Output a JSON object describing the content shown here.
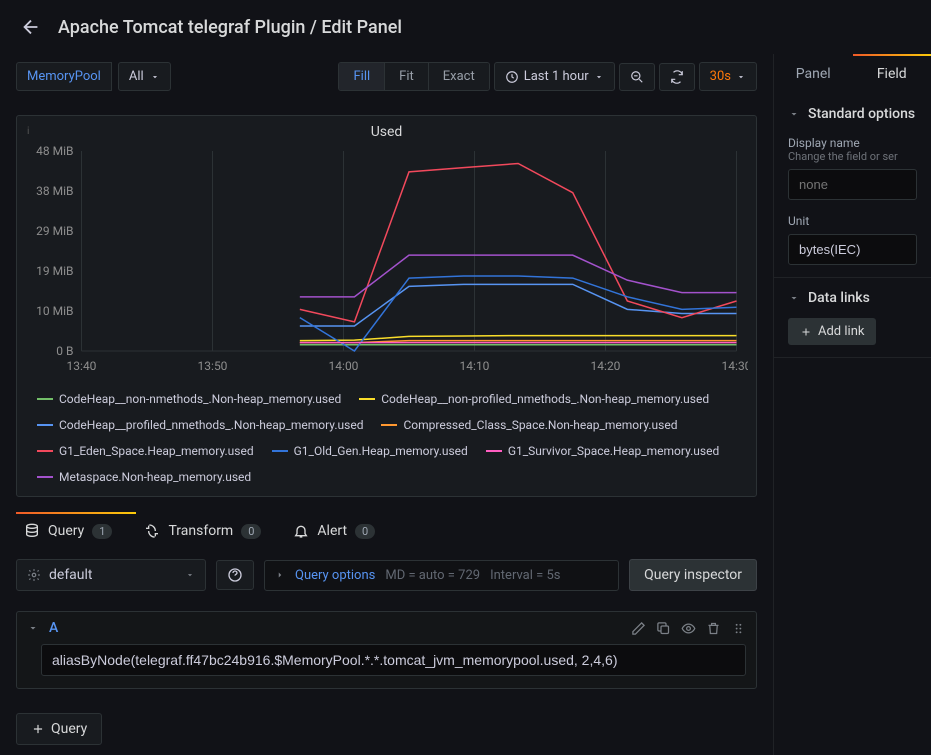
{
  "header": {
    "title": "Apache Tomcat telegraf Plugin / Edit Panel"
  },
  "toolbar": {
    "var_name": "MemoryPool",
    "var_value": "All",
    "mode_fill": "Fill",
    "mode_fit": "Fit",
    "mode_exact": "Exact",
    "time_range": "Last 1 hour",
    "refresh_interval": "30s"
  },
  "chart_data": {
    "type": "line",
    "title": "Used",
    "xlabel": "",
    "ylabel": "",
    "x_ticks": [
      "13:40",
      "13:50",
      "14:00",
      "14:10",
      "14:20",
      "14:30"
    ],
    "y_ticks": [
      "0 B",
      "10 MiB",
      "19 MiB",
      "29 MiB",
      "38 MiB",
      "48 MiB"
    ],
    "ylim": [
      0,
      48
    ],
    "series": [
      {
        "name": "CodeHeap__non-nmethods_.Non-heap_memory.used",
        "color": "#73bf69",
        "values": [
          null,
          null,
          null,
          null,
          1.5,
          1.5,
          1.5,
          1.5,
          1.5,
          1.5,
          1.5,
          1.5,
          1.5
        ]
      },
      {
        "name": "CodeHeap__non-profiled_nmethods_.Non-heap_memory.used",
        "color": "#fade2a",
        "values": [
          null,
          null,
          null,
          null,
          2.5,
          2.6,
          3.5,
          3.6,
          3.7,
          3.7,
          3.7,
          3.7,
          3.7
        ]
      },
      {
        "name": "CodeHeap__profiled_nmethods_.Non-heap_memory.used",
        "color": "#5794f2",
        "values": [
          null,
          null,
          null,
          null,
          6,
          6,
          15.5,
          16,
          16,
          16,
          10,
          9,
          9
        ]
      },
      {
        "name": "Compressed_Class_Space.Non-heap_memory.used",
        "color": "#ff9830",
        "values": [
          null,
          null,
          null,
          null,
          2,
          2,
          2.5,
          2.5,
          2.5,
          2.5,
          2.5,
          2.5,
          2.5
        ]
      },
      {
        "name": "G1_Eden_Space.Heap_memory.used",
        "color": "#f2495c",
        "values": [
          null,
          null,
          null,
          null,
          10,
          7,
          43,
          44,
          45,
          38,
          12,
          8,
          12
        ]
      },
      {
        "name": "G1_Old_Gen.Heap_memory.used",
        "color": "#3274d9",
        "values": [
          null,
          null,
          null,
          null,
          8,
          0,
          17.5,
          18,
          18,
          17.5,
          13,
          10,
          10.5
        ]
      },
      {
        "name": "G1_Survivor_Space.Heap_memory.used",
        "color": "#ff5ec1",
        "values": [
          null,
          null,
          null,
          null,
          2,
          2,
          2,
          2,
          2,
          2,
          2,
          2,
          2
        ]
      },
      {
        "name": "Metaspace.Non-heap_memory.used",
        "color": "#a352cc",
        "values": [
          null,
          null,
          null,
          null,
          13,
          13,
          23,
          23,
          23,
          23,
          17,
          14,
          14
        ]
      }
    ]
  },
  "bottom_tabs": {
    "query": "Query",
    "query_badge": "1",
    "transform": "Transform",
    "transform_badge": "0",
    "alert": "Alert",
    "alert_badge": "0"
  },
  "query_panel": {
    "datasource": "default",
    "options_label": "Query options",
    "md_text": "MD = auto = 729",
    "interval_text": "Interval = 5s",
    "inspector_label": "Query inspector",
    "query_letter": "A",
    "query_text": "aliasByNode(telegraf.ff47bc24b916.$MemoryPool.*.*.tomcat_jvm_memorypool.used, 2,4,6)",
    "add_query_label": "Query"
  },
  "side": {
    "tab_panel": "Panel",
    "tab_field": "Field",
    "standard_options_title": "Standard options",
    "display_name_label": "Display name",
    "display_name_desc": "Change the field or ser",
    "display_name_placeholder": "none",
    "unit_label": "Unit",
    "unit_value": "bytes(IEC)",
    "data_links_title": "Data links",
    "add_link_label": "Add link"
  }
}
